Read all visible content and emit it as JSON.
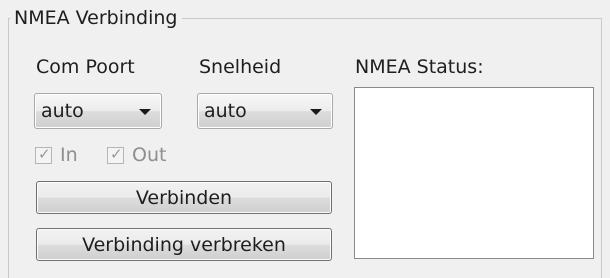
{
  "group": {
    "title": "NMEA Verbinding"
  },
  "com_port": {
    "label": "Com Poort",
    "selected": "auto"
  },
  "speed": {
    "label": "Snelheid",
    "selected": "auto"
  },
  "checkboxes": {
    "in_label": "In",
    "in_checked": true,
    "out_label": "Out",
    "out_checked": true,
    "enabled": false
  },
  "buttons": {
    "connect_label": "Verbinden",
    "disconnect_label": "Verbinding verbreken"
  },
  "status": {
    "label": "NMEA Status:",
    "text": ""
  },
  "icons": {
    "dropdown": "chevron-down-icon",
    "check": "checkmark-icon"
  }
}
